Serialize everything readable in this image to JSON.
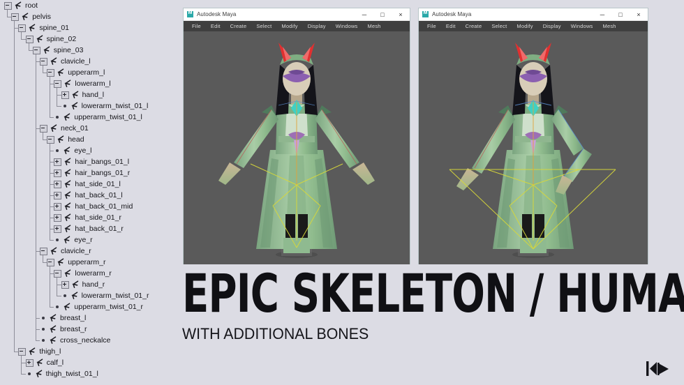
{
  "background_color": "#dcdce4",
  "outliner": {
    "name": "skeleton-outliner",
    "items": [
      {
        "label": "root",
        "depth": 0,
        "handle": "minus"
      },
      {
        "label": "pelvis",
        "depth": 1,
        "handle": "minus"
      },
      {
        "label": "spine_01",
        "depth": 2,
        "handle": "minus"
      },
      {
        "label": "spine_02",
        "depth": 3,
        "handle": "minus"
      },
      {
        "label": "spine_03",
        "depth": 4,
        "handle": "minus"
      },
      {
        "label": "clavicle_l",
        "depth": 5,
        "handle": "minus"
      },
      {
        "label": "upperarm_l",
        "depth": 6,
        "handle": "minus"
      },
      {
        "label": "lowerarm_l",
        "depth": 7,
        "handle": "minus"
      },
      {
        "label": "hand_l",
        "depth": 8,
        "handle": "plus"
      },
      {
        "label": "lowerarm_twist_01_l",
        "depth": 8,
        "handle": "dot"
      },
      {
        "label": "upperarm_twist_01_l",
        "depth": 7,
        "handle": "dot"
      },
      {
        "label": "neck_01",
        "depth": 5,
        "handle": "minus"
      },
      {
        "label": "head",
        "depth": 6,
        "handle": "minus"
      },
      {
        "label": "eye_l",
        "depth": 7,
        "handle": "dot"
      },
      {
        "label": "hair_bangs_01_l",
        "depth": 7,
        "handle": "plus"
      },
      {
        "label": "hair_bangs_01_r",
        "depth": 7,
        "handle": "plus"
      },
      {
        "label": "hat_side_01_l",
        "depth": 7,
        "handle": "plus"
      },
      {
        "label": "hat_back_01_l",
        "depth": 7,
        "handle": "plus"
      },
      {
        "label": "hat_back_01_mid",
        "depth": 7,
        "handle": "plus"
      },
      {
        "label": "hat_side_01_r",
        "depth": 7,
        "handle": "plus"
      },
      {
        "label": "hat_back_01_r",
        "depth": 7,
        "handle": "plus"
      },
      {
        "label": "eye_r",
        "depth": 7,
        "handle": "dot"
      },
      {
        "label": "clavicle_r",
        "depth": 5,
        "handle": "minus"
      },
      {
        "label": "upperarm_r",
        "depth": 6,
        "handle": "minus"
      },
      {
        "label": "lowerarm_r",
        "depth": 7,
        "handle": "minus"
      },
      {
        "label": "hand_r",
        "depth": 8,
        "handle": "plus"
      },
      {
        "label": "lowerarm_twist_01_r",
        "depth": 8,
        "handle": "dot"
      },
      {
        "label": "upperarm_twist_01_r",
        "depth": 7,
        "handle": "dot"
      },
      {
        "label": "breast_l",
        "depth": 5,
        "handle": "dot"
      },
      {
        "label": "breast_r",
        "depth": 5,
        "handle": "dot"
      },
      {
        "label": "cross_neckalce",
        "depth": 5,
        "handle": "dot"
      },
      {
        "label": "thigh_l",
        "depth": 2,
        "handle": "minus"
      },
      {
        "label": "calf_l",
        "depth": 3,
        "handle": "plus"
      },
      {
        "label": "thigh_twist_01_l",
        "depth": 3,
        "handle": "dot"
      }
    ]
  },
  "maya_windows": [
    {
      "name": "maya-window-left",
      "title": "Autodesk Maya",
      "logo": "maya-logo-icon",
      "menus": [
        "File",
        "Edit",
        "Create",
        "Select",
        "Modify",
        "Display",
        "Windows",
        "Mesh"
      ],
      "controls": {
        "minimize": "─",
        "maximize": "□",
        "close": "×"
      },
      "viewport_bg": "#5a5a5a",
      "pose": "t-pose-arms-straight"
    },
    {
      "name": "maya-window-right",
      "title": "Autodesk Maya",
      "logo": "maya-logo-icon",
      "menus": [
        "File",
        "Edit",
        "Create",
        "Select",
        "Modify",
        "Display",
        "Windows",
        "Mesh"
      ],
      "controls": {
        "minimize": "─",
        "maximize": "□",
        "close": "×"
      },
      "viewport_bg": "#5a5a5a",
      "pose": "a-pose-right-arm-bent"
    }
  ],
  "title_block": {
    "main_title": "EPIC SKELETON / HUMANOID RIG",
    "sub_title": "WITH ADDITIONAL BONES"
  },
  "watermark": {
    "name": "kd-logo-watermark",
    "text": "KD"
  }
}
